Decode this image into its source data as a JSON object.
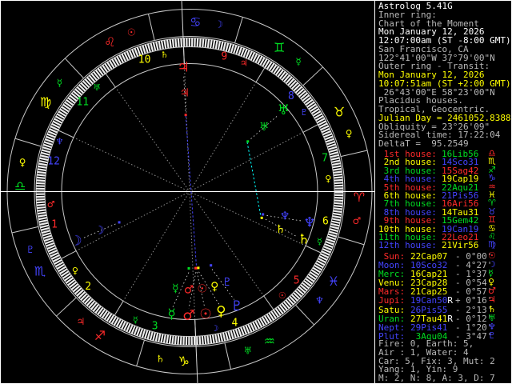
{
  "colors": {
    "red": "#ff2a2a",
    "yellow": "#ffff00",
    "green": "#00dd22",
    "blue": "#4444ff",
    "gray": "#b8b8b8",
    "white": "#ffffff",
    "cyan": "#00ffff",
    "wheel_line": "#c8c8c8",
    "cusp_dotted": "#8c8c8c",
    "axis": "#ffffff",
    "stripe": "#ececec",
    "pointer": "#e0e0e0"
  },
  "panel": {
    "info_lines": [
      {
        "text": "Astrolog 5.41G",
        "color": "white"
      },
      {
        "text": "Inner ring:",
        "color": "gray"
      },
      {
        "text": "Chart of the Moment",
        "color": "gray"
      },
      {
        "text": "Mon January 12, 2026",
        "color": "white"
      },
      {
        "text": "12:07:00am (ST -8:00 GMT)",
        "color": "white"
      },
      {
        "text": "San Francisco, CA",
        "color": "gray"
      },
      {
        "text": "122°41'00\"W 37°79'00\"N",
        "color": "gray"
      },
      {
        "text": "Outer ring - Transit:",
        "color": "gray"
      },
      {
        "text": "Mon January 12, 2026",
        "color": "yellow"
      },
      {
        "text": "10:07:51am (ST +2:00 GMT)",
        "color": "yellow"
      },
      {
        "text": " 26°43'00\"E 58°23'00\"N",
        "color": "gray"
      },
      {
        "text": "Placidus houses.",
        "color": "gray"
      },
      {
        "text": "Tropical, Geocentric.",
        "color": "gray"
      },
      {
        "text": "Julian Day = 2461052.8388",
        "color": "yellow"
      },
      {
        "text": "Obliquity = 23°26'09\"",
        "color": "gray"
      },
      {
        "text": "Sidereal time: 17:22:04",
        "color": "gray"
      },
      {
        "text": "DeltaT =  95.2549",
        "color": "gray"
      }
    ],
    "houses": [
      {
        "label": " 1st house:",
        "label_color": "red",
        "value": "16Lib56",
        "value_color": "green",
        "glyph": "♎",
        "glyph_color": "red"
      },
      {
        "label": " 2nd house:",
        "label_color": "yellow",
        "value": "14Sco31",
        "value_color": "blue",
        "glyph": "♏",
        "glyph_color": "yellow"
      },
      {
        "label": " 3rd house:",
        "label_color": "green",
        "value": "15Sag42",
        "value_color": "red",
        "glyph": "♐",
        "glyph_color": "green"
      },
      {
        "label": " 4th house:",
        "label_color": "blue",
        "value": "19Cap19",
        "value_color": "yellow",
        "glyph": "♑",
        "glyph_color": "blue"
      },
      {
        "label": " 5th house:",
        "label_color": "red",
        "value": "22Aqu21",
        "value_color": "green",
        "glyph": "♒",
        "glyph_color": "red"
      },
      {
        "label": " 6th house:",
        "label_color": "yellow",
        "value": "21Pis56",
        "value_color": "blue",
        "glyph": "♓",
        "glyph_color": "yellow"
      },
      {
        "label": " 7th house:",
        "label_color": "green",
        "value": "16Ari56",
        "value_color": "red",
        "glyph": "♈",
        "glyph_color": "green"
      },
      {
        "label": " 8th house:",
        "label_color": "blue",
        "value": "14Tau31",
        "value_color": "yellow",
        "glyph": "♉",
        "glyph_color": "blue"
      },
      {
        "label": " 9th house:",
        "label_color": "red",
        "value": "15Gem42",
        "value_color": "green",
        "glyph": "♊",
        "glyph_color": "red"
      },
      {
        "label": "10th house:",
        "label_color": "yellow",
        "value": "19Can19",
        "value_color": "blue",
        "glyph": "♋",
        "glyph_color": "yellow"
      },
      {
        "label": "11th house:",
        "label_color": "green",
        "value": "22Leo21",
        "value_color": "red",
        "glyph": "♌",
        "glyph_color": "green"
      },
      {
        "label": "12th house:",
        "label_color": "blue",
        "value": "21Vir56",
        "value_color": "yellow",
        "glyph": "♍",
        "glyph_color": "blue"
      }
    ],
    "planets": [
      {
        "label": " Sun:",
        "color": "red",
        "value": "22Cap07",
        "value_color": "yellow",
        "retro": "",
        "delta": "- 0°00'",
        "glyph": "☉"
      },
      {
        "label": "Moon:",
        "color": "blue",
        "value": "10Sco32",
        "value_color": "blue",
        "retro": "",
        "delta": "- 4°27'",
        "glyph": "☽"
      },
      {
        "label": "Merc:",
        "color": "green",
        "value": "16Cap21",
        "value_color": "yellow",
        "retro": "",
        "delta": "- 1°37'",
        "glyph": "☿"
      },
      {
        "label": "Venu:",
        "color": "yellow",
        "value": "23Cap28",
        "value_color": "yellow",
        "retro": "",
        "delta": "- 0°54'",
        "glyph": "♀"
      },
      {
        "label": "Mars:",
        "color": "red",
        "value": "21Cap25",
        "value_color": "yellow",
        "retro": "",
        "delta": "- 0°57'",
        "glyph": "♂"
      },
      {
        "label": "Jupi:",
        "color": "red",
        "value": "19Can50",
        "value_color": "blue",
        "retro": "R",
        "delta": "+ 0°16'",
        "glyph": "♃"
      },
      {
        "label": "Satu:",
        "color": "yellow",
        "value": "26Pis55",
        "value_color": "blue",
        "retro": "",
        "delta": "- 2°13'",
        "glyph": "♄"
      },
      {
        "label": "Uran:",
        "color": "green",
        "value": "27Tau41",
        "value_color": "yellow",
        "retro": "R",
        "delta": "- 0°12'",
        "glyph": "♅"
      },
      {
        "label": "Nept:",
        "color": "blue",
        "value": "29Pis41",
        "value_color": "blue",
        "retro": "",
        "delta": "- 1°20'",
        "glyph": "♆"
      },
      {
        "label": "Plut:",
        "color": "blue",
        "value": " 3Aqu04",
        "value_color": "green",
        "retro": "",
        "delta": "- 3°47'",
        "glyph": "♇"
      }
    ],
    "stats": [
      "Fire: 0, Earth: 5,",
      "Air : 1, Water: 4",
      "Car: 5, Fix: 3, Mut: 2",
      "Yang: 1, Yin: 9",
      "M: 2, N: 8, A: 3, D: 7"
    ]
  },
  "wheel": {
    "asc_lambda": 196.933,
    "signs": [
      {
        "name": "Aries",
        "glyph": "♈",
        "color": "red",
        "ruler": "♂",
        "ruler_color": "red"
      },
      {
        "name": "Taurus",
        "glyph": "♉",
        "color": "yellow",
        "ruler": "♀",
        "ruler_color": "yellow"
      },
      {
        "name": "Gemini",
        "glyph": "♊",
        "color": "green",
        "ruler": "☿",
        "ruler_color": "green"
      },
      {
        "name": "Cancer",
        "glyph": "♋",
        "color": "blue",
        "ruler": "☽",
        "ruler_color": "blue"
      },
      {
        "name": "Leo",
        "glyph": "♌",
        "color": "red",
        "ruler": "☉",
        "ruler_color": "red"
      },
      {
        "name": "Virgo",
        "glyph": "♍",
        "color": "yellow",
        "ruler": "☿",
        "ruler_color": "green"
      },
      {
        "name": "Libra",
        "glyph": "♎",
        "color": "green",
        "ruler": "♀",
        "ruler_color": "yellow"
      },
      {
        "name": "Scorpio",
        "glyph": "♏",
        "color": "blue",
        "ruler": "♇",
        "ruler_color": "blue"
      },
      {
        "name": "Sagittarius",
        "glyph": "♐",
        "color": "red",
        "ruler": "♃",
        "ruler_color": "red"
      },
      {
        "name": "Capricorn",
        "glyph": "♑",
        "color": "yellow",
        "ruler": "♄",
        "ruler_color": "yellow"
      },
      {
        "name": "Aquarius",
        "glyph": "♒",
        "color": "green",
        "ruler": "♅",
        "ruler_color": "green"
      },
      {
        "name": "Pisces",
        "glyph": "♓",
        "color": "blue",
        "ruler": "♆",
        "ruler_color": "blue"
      }
    ],
    "house_cusps": {
      "lambdas": [
        196.933,
        224.517,
        255.7,
        289.317,
        322.35,
        351.933,
        16.933,
        44.517,
        75.7,
        109.317,
        142.35,
        171.933
      ],
      "number_colors": [
        "red",
        "yellow",
        "green",
        "yellow",
        "red",
        "yellow",
        "green",
        "blue",
        "red",
        "yellow",
        "green",
        "blue"
      ],
      "rulers": [
        {
          "glyph": "♂",
          "color": "red"
        },
        {
          "glyph": "♀",
          "color": "yellow"
        },
        {
          "glyph": "☿",
          "color": "green"
        },
        {
          "glyph": "☽",
          "color": "blue"
        },
        {
          "glyph": "☉",
          "color": "red"
        },
        {
          "glyph": "☿",
          "color": "green"
        },
        {
          "glyph": "♀",
          "color": "yellow"
        },
        {
          "glyph": "♇",
          "color": "blue"
        },
        {
          "glyph": "♃",
          "color": "red"
        },
        {
          "glyph": "♄",
          "color": "yellow"
        },
        {
          "glyph": "♅",
          "color": "green"
        },
        {
          "glyph": "♆",
          "color": "blue"
        }
      ]
    },
    "planets": [
      {
        "name": "Sun",
        "glyph": "☉",
        "color": "red",
        "lambda": 292.117,
        "beta_display": 277.4
      },
      {
        "name": "Moon",
        "glyph": "☽",
        "color": "blue",
        "lambda": 220.533,
        "beta_display": 203.6
      },
      {
        "name": "Mercury",
        "glyph": "☿",
        "color": "green",
        "lambda": 286.35,
        "beta_display": 261.7
      },
      {
        "name": "Venus",
        "glyph": "♀",
        "color": "yellow",
        "lambda": 293.467,
        "beta_display": 284.7
      },
      {
        "name": "Mars",
        "glyph": "♂",
        "color": "red",
        "lambda": 291.417,
        "beta_display": 269.6
      },
      {
        "name": "Jupiter",
        "glyph": "♃",
        "color": "red",
        "lambda": 109.833,
        "beta_display": 92.9
      },
      {
        "name": "Saturn",
        "glyph": "♄",
        "color": "yellow",
        "lambda": 356.917,
        "beta_display": 337.2
      },
      {
        "name": "Uranus",
        "glyph": "♅",
        "color": "green",
        "lambda": 57.683,
        "beta_display": 40.8
      },
      {
        "name": "Neptune",
        "glyph": "♆",
        "color": "blue",
        "lambda": 359.683,
        "beta_display": 345.4
      },
      {
        "name": "Pluto",
        "glyph": "♇",
        "color": "blue",
        "lambda": 303.067,
        "beta_display": 292.4
      }
    ],
    "aspects": [
      {
        "a": "Jupiter",
        "b": "Sun",
        "color": "blue"
      },
      {
        "a": "Uranus",
        "b": "Saturn",
        "color": "cyan"
      }
    ]
  }
}
